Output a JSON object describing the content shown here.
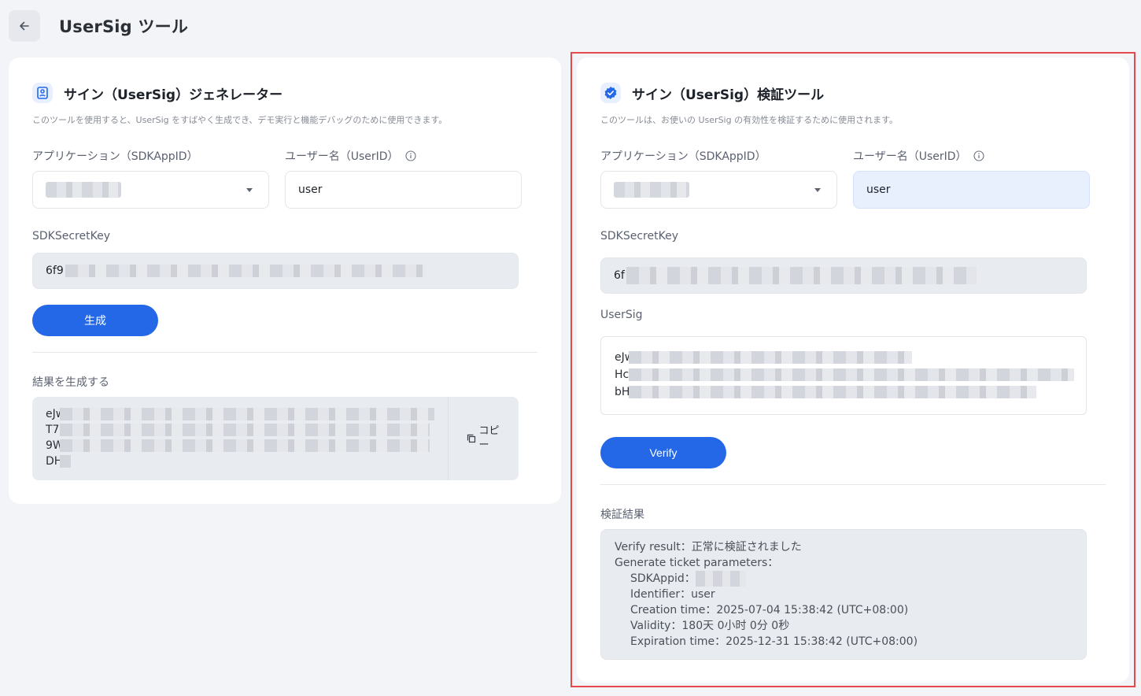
{
  "header": {
    "title": "UserSig ツール"
  },
  "generator": {
    "title": "サイン（UserSig）ジェネレーター",
    "description": "このツールを使用すると、UserSig をすばやく生成でき、デモ実行と機能デバッグのために使用できます。",
    "app_label": "アプリケーション（SDKAppID）",
    "user_label": "ユーザー名（UserID）",
    "user_value": "user",
    "secret_label": "SDKSecretKey",
    "secret_prefix": "6f9",
    "generate_button": "生成",
    "result_label": "結果を生成する",
    "result_prefixes": [
      "eJw",
      "T7x",
      "9W",
      "DH"
    ],
    "copy_label": "コピー"
  },
  "verifier": {
    "title": "サイン（UserSig）検証ツール",
    "description": "このツールは、お使いの UserSig の有効性を検証するために使用されます。",
    "app_label": "アプリケーション（SDKAppID）",
    "user_label": "ユーザー名（UserID）",
    "user_value": "user",
    "secret_label": "SDKSecretKey",
    "secret_prefix": "6f",
    "usersig_label": "UserSig",
    "usersig_prefixes": [
      "eJw",
      "Hc",
      "bH"
    ],
    "verify_button": "Verify",
    "result_label": "検証結果",
    "result": {
      "line1": "Verify result：正常に検証されました",
      "line2": "Generate ticket parameters：",
      "sdkappid_label": "SDKAppid：",
      "identifier": "Identifier：user",
      "creation": "Creation time：2025-07-04 15:38:42 (UTC+08:00)",
      "validity": "Validity：180天 0小时 0分 0秒",
      "expiration": "Expiration time：2025-12-31 15:38:42 (UTC+08:00)"
    }
  },
  "colors": {
    "primary": "#2468e8",
    "highlight": "#e5484d"
  }
}
